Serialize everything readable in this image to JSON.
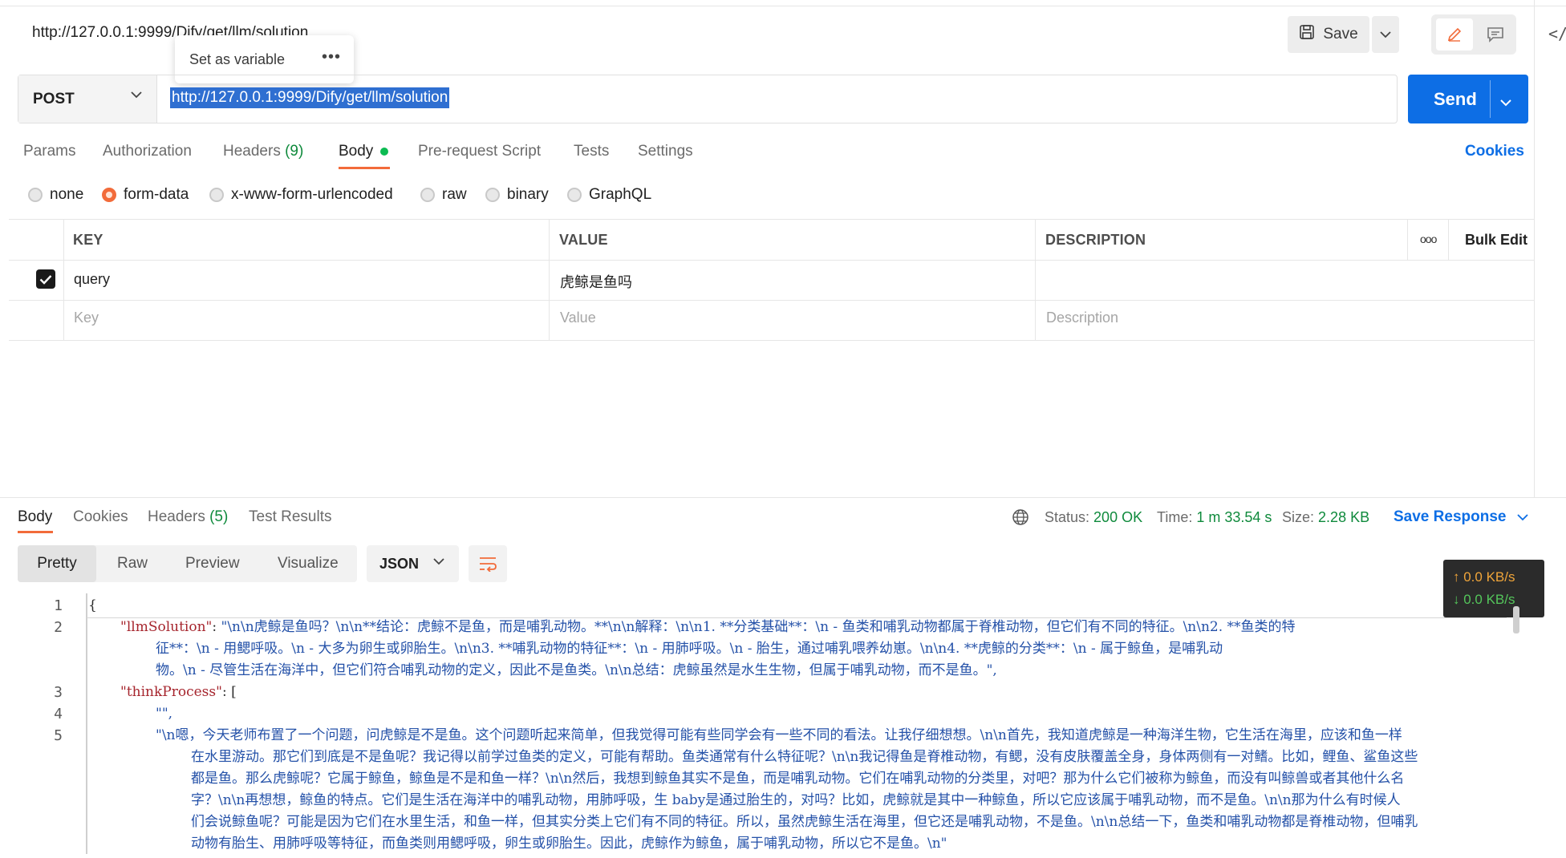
{
  "request": {
    "title": "http://127.0.0.1:9999/Dify/get/llm/solution",
    "method": "POST",
    "url": "http://127.0.0.1:9999/Dify/get/llm/solution",
    "save_label": "Save",
    "send_label": "Send",
    "tooltip_label": "Set as variable"
  },
  "tabs": {
    "params": "Params",
    "authorization": "Authorization",
    "headers": "Headers",
    "headers_count": "(9)",
    "body": "Body",
    "pre_request": "Pre-request Script",
    "tests": "Tests",
    "settings": "Settings",
    "cookies": "Cookies"
  },
  "body_types": {
    "none": "none",
    "form_data": "form-data",
    "urlencoded": "x-www-form-urlencoded",
    "raw": "raw",
    "binary": "binary",
    "graphql": "GraphQL",
    "selected": "form-data"
  },
  "params_table": {
    "headers": {
      "key": "KEY",
      "value": "VALUE",
      "description": "DESCRIPTION",
      "bulk_edit": "Bulk Edit"
    },
    "rows": [
      {
        "checked": true,
        "key": "query",
        "value": "虎鲸是鱼吗",
        "description": ""
      }
    ],
    "placeholder": {
      "key": "Key",
      "value": "Value",
      "description": "Description"
    }
  },
  "response": {
    "tabs": {
      "body": "Body",
      "cookies": "Cookies",
      "headers": "Headers",
      "headers_count": "(5)",
      "test_results": "Test Results"
    },
    "status_label": "Status:",
    "status_value": "200 OK",
    "time_label": "Time:",
    "time_value": "1 m 33.54 s",
    "size_label": "Size:",
    "size_value": "2.28 KB",
    "save_response": "Save Response",
    "views": {
      "pretty": "Pretty",
      "raw": "Raw",
      "preview": "Preview",
      "visualize": "Visualize"
    },
    "format": "JSON",
    "speed_up": "↑ 0.0 KB/s",
    "speed_down": "↓ 0.0 KB/s"
  },
  "code": {
    "line_numbers": [
      "1",
      "2",
      "3",
      "4",
      "5"
    ],
    "l1": "{",
    "l2_key": "\"llmSolution\"",
    "l2_colon": ": ",
    "l2_a": "\"\\n\\n虎鲸是鱼吗？\\n\\n**结论：虎鲸不是鱼，而是哺乳动物。**\\n\\n解释：\\n\\n1. **分类基础**：\\n   - 鱼类和哺乳动物都属于脊椎动物，但它们有不同的特征。\\n\\n2. **鱼类的特",
    "l2_b": "征**：\\n   - 用鳃呼吸。\\n   - 大多为卵生或卵胎生。\\n\\n3. **哺乳动物的特征**：\\n   - 用肺呼吸。\\n   - 胎生，通过哺乳喂养幼崽。\\n\\n4. **虎鲸的分类**：\\n   - 属于鲸鱼，是哺乳动",
    "l2_c": "物。\\n   - 尽管生活在海洋中，但它们符合哺乳动物的定义，因此不是鱼类。\\n\\n总结：虎鲸虽然是水生生物，但属于哺乳动物，而不是鱼。\",",
    "l3_key": "\"thinkProcess\"",
    "l3_rest": ": [",
    "l4": "\"\",",
    "l5_a": "\"\\n嗯，今天老师布置了一个问题，问虎鲸是不是鱼。这个问题听起来简单，但我觉得可能有些同学会有一些不同的看法。让我仔细想想。\\n\\n首先，我知道虎鲸是一种海洋生物，它生活在海里，应该和鱼一样",
    "l5_b": "在水里游动。那它们到底是不是鱼呢？我记得以前学过鱼类的定义，可能有帮助。鱼类通常有什么特征呢？\\n\\n我记得鱼是脊椎动物，有鳃，没有皮肤覆盖全身，身体两侧有一对鳍。比如，鲤鱼、鲨鱼这些",
    "l5_c": "都是鱼。那么虎鲸呢？它属于鲸鱼，鲸鱼是不是和鱼一样？\\n\\n然后，我想到鲸鱼其实不是鱼，而是哺乳动物。它们在哺乳动物的分类里，对吧？那为什么它们被称为鲸鱼，而没有叫鲸兽或者其他什么名",
    "l5_d": "字？\\n\\n再想想，鲸鱼的特点。它们是生活在海洋中的哺乳动物，用肺呼吸，生 baby是通过胎生的，对吗？比如，虎鲸就是其中一种鲸鱼，所以它应该属于哺乳动物，而不是鱼。\\n\\n那为什么有时候人",
    "l5_e": "们会说鲸鱼呢？可能是因为它们在水里生活，和鱼一样，但其实分类上它们有不同的特征。所以，虽然虎鲸生活在海里，但它还是哺乳动物，不是鱼。\\n\\n总结一下，鱼类和哺乳动物都是脊椎动物，但哺乳",
    "l5_f": "动物有胎生、用肺呼吸等特征，而鱼类则用鳃呼吸，卵生或卵胎生。因此，虎鲸作为鲸鱼，属于哺乳动物，所以它不是鱼。\\n\""
  },
  "colors": {
    "accent": "#f26b3a",
    "send": "#0d6ee5",
    "status_ok": "#0f8a3c"
  }
}
